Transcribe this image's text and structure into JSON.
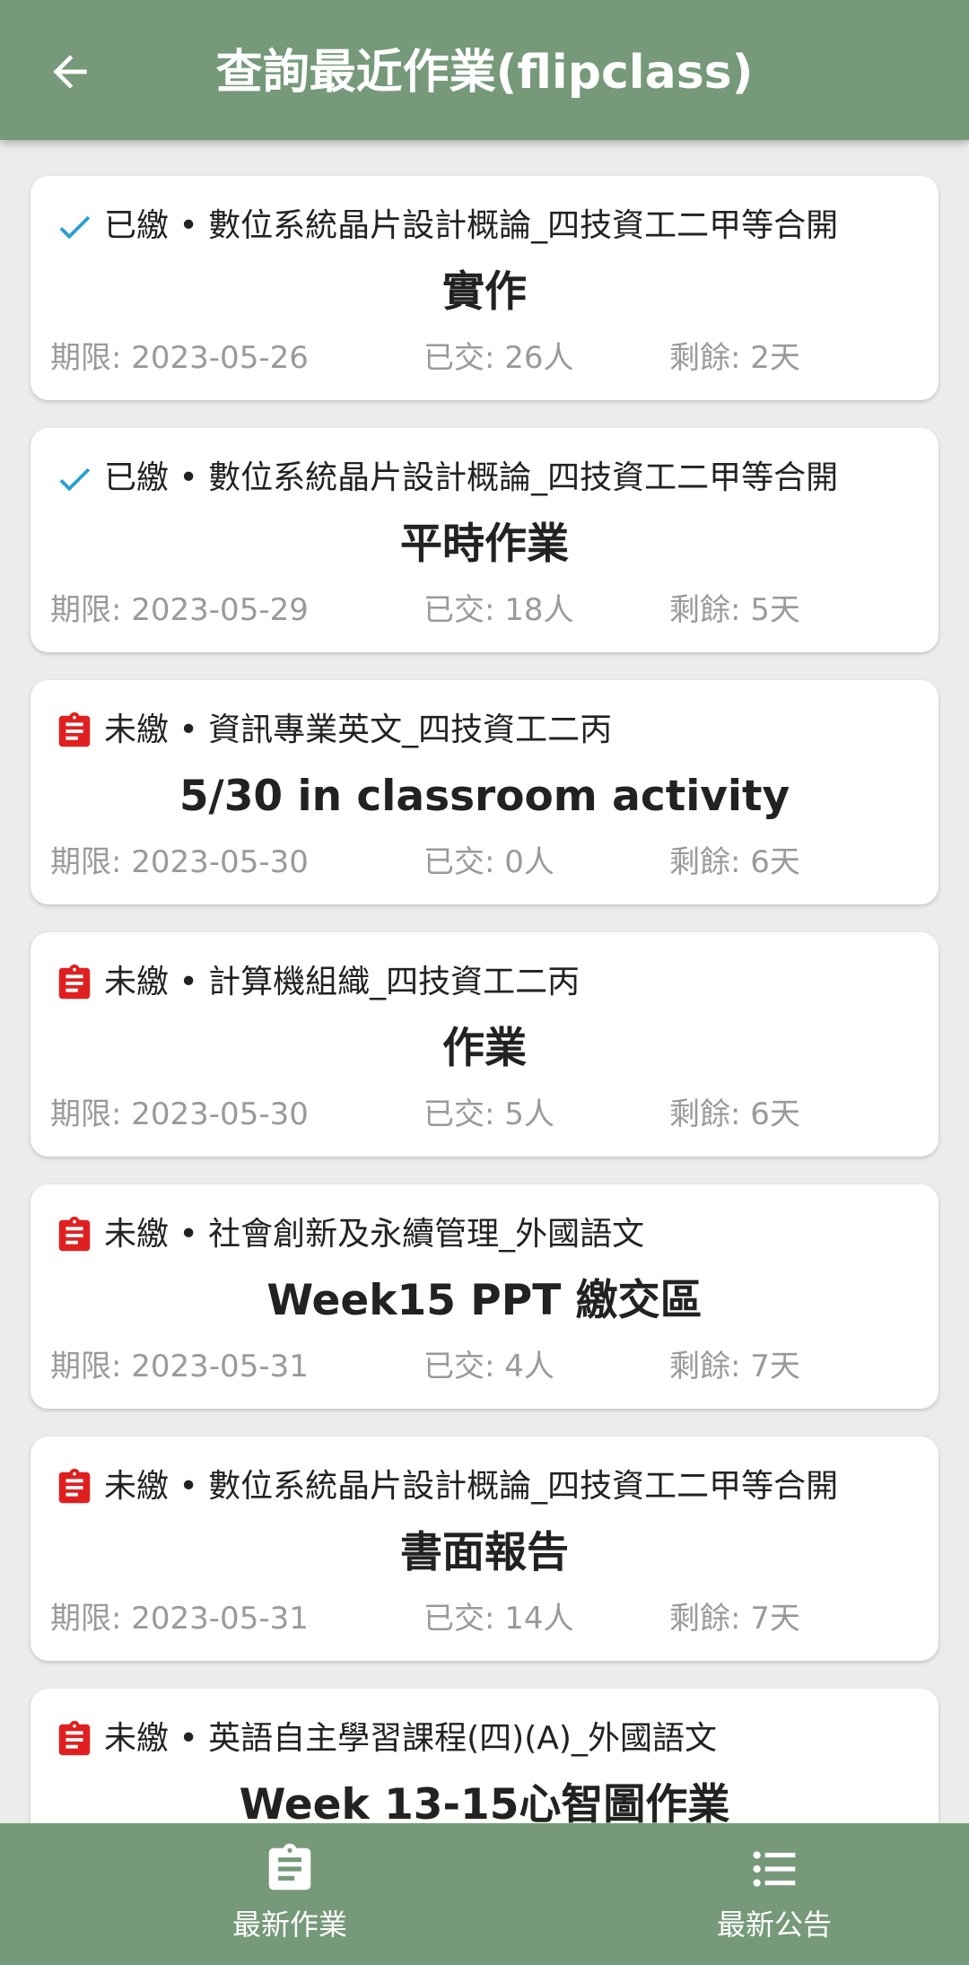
{
  "header": {
    "title": "查詢最近作業(flipclass)",
    "back_icon": "arrow-left-icon"
  },
  "colors": {
    "header_bg": "#76997a",
    "submitted_check": "#2a9fd6",
    "unsubmitted_icon": "#e02020",
    "meta_text": "#9a9a9a"
  },
  "assignments": [
    {
      "status": "已繳",
      "course": "數位系統晶片設計概論_四技資工二甲等合開",
      "title": "實作",
      "deadline": "期限: 2023-05-26",
      "submitted": "已交: 26人",
      "remaining": "剩餘: 2天",
      "line": ""
    },
    {
      "status": "已繳",
      "course": "數位系統晶片設計概論_四技資工二甲等合開",
      "title": "平時作業",
      "deadline": "期限: 2023-05-29",
      "submitted": "已交: 18人",
      "remaining": "剩餘: 5天",
      "line": ""
    },
    {
      "status": "未繳",
      "course": "資訊專業英文_四技資工二丙",
      "title": "5/30 in classroom activity",
      "deadline": "期限: 2023-05-30",
      "submitted": "已交: 0人",
      "remaining": "剩餘: 6天",
      "line": ""
    },
    {
      "status": "未繳",
      "course": "計算機組織_四技資工二丙",
      "title": "作業",
      "deadline": "期限: 2023-05-30",
      "submitted": "已交: 5人",
      "remaining": "剩餘: 6天",
      "line": ""
    },
    {
      "status": "未繳",
      "course": "社會創新及永續管理_外國語文",
      "title": "Week15  PPT 繳交區",
      "deadline": "期限: 2023-05-31",
      "submitted": "已交: 4人",
      "remaining": "剩餘: 7天",
      "line": ""
    },
    {
      "status": "未繳",
      "course": "數位系統晶片設計概論_四技資工二甲等合開",
      "title": "書面報告",
      "deadline": "期限: 2023-05-31",
      "submitted": "已交: 14人",
      "remaining": "剩餘: 7天",
      "line": ""
    },
    {
      "status": "未繳",
      "course": "英語自主學習課程(四)(A)_外國語文",
      "title": "Week 13-15心智圖作業",
      "deadline": "",
      "submitted": "",
      "remaining": "",
      "line": ""
    }
  ],
  "bottom_nav": [
    {
      "label": "最新作業",
      "icon": "clipboard-icon"
    },
    {
      "label": "最新公告",
      "icon": "list-icon"
    }
  ]
}
